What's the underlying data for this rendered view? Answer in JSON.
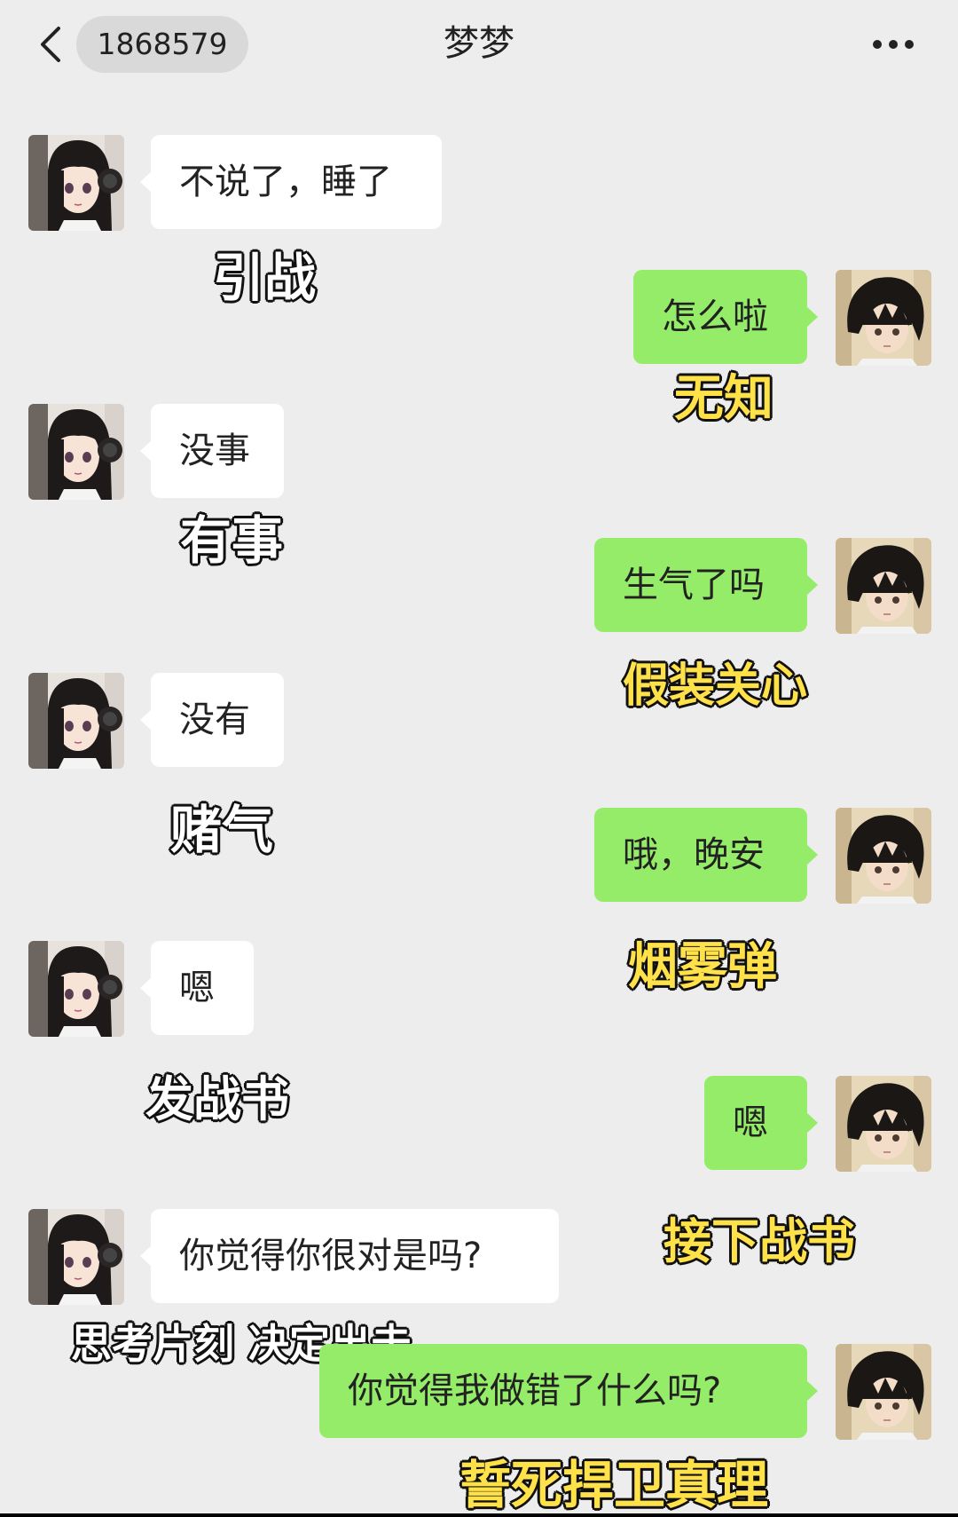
{
  "header": {
    "back_label": "1868579",
    "title": "梦梦"
  },
  "contacts": {
    "her_avatar": "girl-headphones-avatar",
    "me_avatar": "boy-avatar"
  },
  "messages": [
    {
      "from": "her",
      "text": "不说了，睡了",
      "caption": "引战"
    },
    {
      "from": "me",
      "text": "怎么啦",
      "caption": "无知"
    },
    {
      "from": "her",
      "text": "没事",
      "caption": "有事"
    },
    {
      "from": "me",
      "text": "生气了吗",
      "caption": "假装关心"
    },
    {
      "from": "her",
      "text": "没有",
      "caption": "赌气"
    },
    {
      "from": "me",
      "text": "哦，晚安",
      "caption": "烟雾弹"
    },
    {
      "from": "her",
      "text": "嗯",
      "caption": "发战书"
    },
    {
      "from": "me",
      "text": "嗯",
      "caption": "接下战书"
    },
    {
      "from": "her",
      "text": "你觉得你很对是吗?",
      "caption": "思考片刻 决定出击"
    },
    {
      "from": "me",
      "text": "你觉得我做错了什么吗?",
      "caption": "誓死捍卫真理"
    }
  ],
  "colors": {
    "chat_background": "#ededed",
    "my_bubble": "#95ec69",
    "her_bubble": "#ffffff",
    "caption_white": "#ffffff",
    "caption_yellow": "#ffe14a"
  }
}
